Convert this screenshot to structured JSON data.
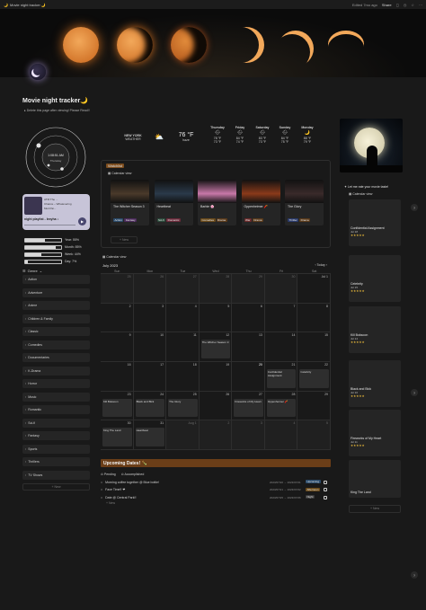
{
  "topbar": {
    "title": "Movie night tracker 🌙",
    "edited": "Edited 7mo ago",
    "share": "Share"
  },
  "page": {
    "title": "Movie night tracker🌙",
    "note": "Delete this page after viewing! Please Read!!"
  },
  "clock": {
    "time": "1:08:51 AM",
    "day": "Thursday"
  },
  "player": {
    "track1": "ATM The ...",
    "track2": "Muit Pai...",
    "song": "Chance – Whatevering",
    "time": "0:00",
    "title": "night playlist - lexyha ♪"
  },
  "stats": [
    {
      "label": "Year: 55%",
      "pct": 55
    },
    {
      "label": "Month: 85%",
      "pct": 85
    },
    {
      "label": "Week: 44%",
      "pct": 44
    },
    {
      "label": "Day: 7%",
      "pct": 7
    }
  ],
  "genres": {
    "header": "Genre",
    "items": [
      "Action",
      "Adventure",
      "Anime",
      "Children & Family",
      "Classic",
      "Comedies",
      "Documentaries",
      "K-Drama",
      "Horror",
      "Music",
      "Romantic",
      "Sci-fi",
      "Fantasy",
      "Sports",
      "Thrillers",
      "TV Shows"
    ],
    "new": "+ New"
  },
  "weather": {
    "city": "NEW YORK",
    "label": "WEATHER",
    "temp": "76 °F",
    "cond": "haze",
    "days": [
      {
        "d": "Thursday",
        "hi": "78 °F",
        "lo": "73 °F"
      },
      {
        "d": "Friday",
        "hi": "84 °F",
        "lo": "74 °F"
      },
      {
        "d": "Saturday",
        "hi": "83 °F",
        "lo": "73 °F"
      },
      {
        "d": "Sunday",
        "hi": "84 °F",
        "lo": "75 °F"
      },
      {
        "d": "Monday",
        "hi": "88 °F",
        "lo": "79 °F"
      }
    ]
  },
  "gallery": {
    "title": "Watchlist",
    "tab": "Calendar view",
    "new": "+ New",
    "cards": [
      {
        "title": "The Witcher Season 3",
        "tags": [
          "Action",
          "Fantasy"
        ],
        "status": "watching",
        "color": "#4a3a2a"
      },
      {
        "title": "Heartbeat",
        "tags": [
          "Sci-fi",
          "Romantic"
        ],
        "status": "done",
        "color": "#2a3a4a"
      },
      {
        "title": "Barbie 🌸",
        "tags": [
          "Comedies",
          "Drama"
        ],
        "status": "watching",
        "color": "#c878a8"
      },
      {
        "title": "Oppenheimer 🧨",
        "tags": [
          "War",
          "Drama"
        ],
        "status": "done",
        "color": "#8a3a1a"
      },
      {
        "title": "The Glory",
        "tags": [
          "Thriller",
          "Drama"
        ],
        "status": "done",
        "color": "#3a2a2a"
      }
    ]
  },
  "calendar": {
    "tab": "Calendar view",
    "month": "July 2023",
    "today": "Today",
    "days": [
      "Sun",
      "Mon",
      "Tue",
      "Wed",
      "Thu",
      "Fri",
      "Sat"
    ],
    "weeks": [
      [
        "25",
        "26",
        "27",
        "28",
        "29",
        "30",
        "Jul 1"
      ],
      [
        "2",
        "3",
        "4",
        "5",
        "6",
        "7",
        "8"
      ],
      [
        "9",
        "10",
        "11",
        "12",
        "13",
        "14",
        "15"
      ],
      [
        "16",
        "17",
        "18",
        "19",
        "20",
        "21",
        "22"
      ],
      [
        "23",
        "24",
        "25",
        "26",
        "27",
        "28",
        "29"
      ],
      [
        "30",
        "31",
        "Aug 1",
        "2",
        "3",
        "4",
        "5"
      ]
    ],
    "events": [
      {
        "w": 2,
        "d": 3,
        "t": "The Witcher Season 3"
      },
      {
        "w": 3,
        "d": 5,
        "t": "Confidential Assignment"
      },
      {
        "w": 3,
        "d": 6,
        "t": "Celebrity"
      },
      {
        "w": 4,
        "d": 0,
        "t": "Kill Boksoon"
      },
      {
        "w": 4,
        "d": 1,
        "t": "Black and Blck"
      },
      {
        "w": 4,
        "d": 2,
        "t": "The Glory"
      },
      {
        "w": 4,
        "d": 4,
        "t": "Fireworks of My Heart"
      },
      {
        "w": 4,
        "d": 5,
        "t": "Oppenheimer 🧨"
      },
      {
        "w": 5,
        "d": 0,
        "t": "King The Land"
      },
      {
        "w": 5,
        "d": 1,
        "t": "Heartbeat"
      }
    ]
  },
  "upcoming": {
    "title": "Upcoming Dates! 🍾",
    "tab1": "Pending",
    "tab2": "Accomplished",
    "items": [
      {
        "t": "Morning coffee together @ Blue bottle!",
        "date": "2023/07/20 → 2023/07/21",
        "tag": "Upcoming"
      },
      {
        "t": "Face Time!! ❤",
        "date": "2023/07/21 → 2023/07/22",
        "tag": "Afternoon"
      },
      {
        "t": "Date @ Central Park!!",
        "date": "2023/07/25 → 2023/07/26",
        "tag": "Night"
      }
    ],
    "new": "+ New"
  },
  "reviews": {
    "header": "Let me rate your movie taste!",
    "tab": "Calendar view",
    "cards": [
      {
        "t": "Confidential Assignment",
        "date": "Jul 18"
      },
      {
        "t": "Celebrity",
        "date": "Jul 15"
      },
      {
        "t": "Kill Boksoon",
        "date": "Jul 14"
      },
      {
        "t": "Black and Blck",
        "date": "Jul 16"
      },
      {
        "t": "Fireworks of My Heart",
        "date": "Jul 11"
      },
      {
        "t": "King The Land",
        "date": ""
      }
    ],
    "new": "+ New"
  }
}
